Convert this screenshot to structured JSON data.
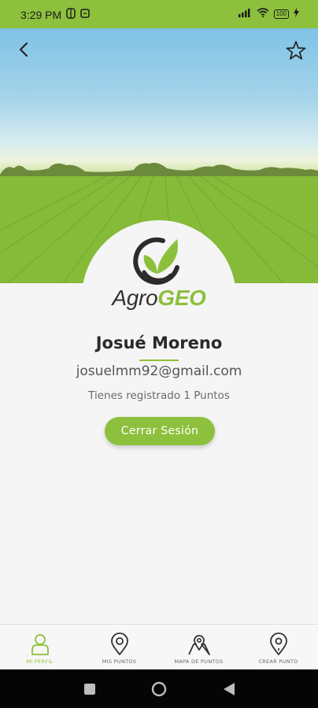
{
  "status_bar": {
    "time": "3:29 PM",
    "battery": "100",
    "icons": [
      "data-saver-icon",
      "sync-icon",
      "signal-icon",
      "wifi-icon",
      "battery-icon",
      "charging-icon"
    ]
  },
  "header": {
    "back_icon": "chevron-left-icon",
    "favorite_icon": "star-outline-icon"
  },
  "logo": {
    "text_part1": "Agro",
    "text_part2": "GEO"
  },
  "profile": {
    "name": "Josué Moreno",
    "email": "josuelmm92@gmail.com",
    "points_text": "Tienes registrado 1 Puntos"
  },
  "actions": {
    "logout_label": "Cerrar Sesión"
  },
  "bottom_nav": {
    "items": [
      {
        "label": "MI PERFIL",
        "icon": "person-icon",
        "active": true
      },
      {
        "label": "MIS PUNTOS",
        "icon": "location-pin-icon",
        "active": false
      },
      {
        "label": "MAPA DE PUNTOS",
        "icon": "map-pin-icon",
        "active": false
      },
      {
        "label": "CREAR PUNTO",
        "icon": "add-location-icon",
        "active": false
      }
    ]
  },
  "colors": {
    "accent": "#8dc03c",
    "text_dark": "#2a2a2a",
    "background": "#f5f5f5"
  }
}
